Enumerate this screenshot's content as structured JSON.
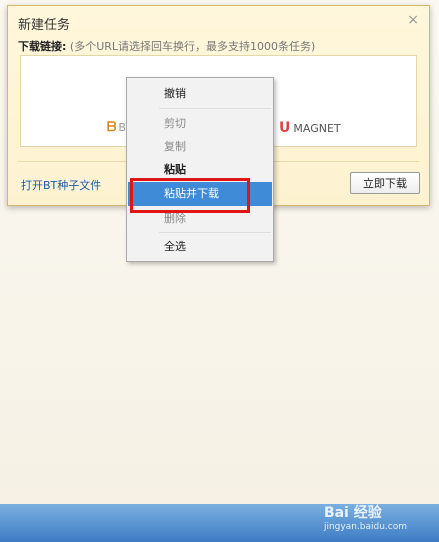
{
  "dialog": {
    "title": "新建任务",
    "close": "×",
    "download_label": "下载链接:",
    "hint": "(多个URL请选择回车换行，最多支持1000条任务)",
    "protocols": {
      "bt": "BT",
      "magnet": "MAGNET"
    },
    "open_bt": "打开BT种子文件",
    "download_now": "立即下载"
  },
  "context_menu": {
    "items": [
      {
        "label": "撤销",
        "state": "enabled"
      },
      {
        "label": "剪切",
        "state": "disabled"
      },
      {
        "label": "复制",
        "state": "disabled"
      },
      {
        "label": "粘贴",
        "state": "bold"
      },
      {
        "label": "粘贴并下载",
        "state": "highlighted"
      },
      {
        "label": "删除",
        "state": "disabled"
      },
      {
        "label": "全选",
        "state": "enabled"
      }
    ]
  },
  "watermark": {
    "brand": "Bai 经验",
    "sub": "jingyan.baidu.com"
  },
  "colors": {
    "highlight": "#3f8bd8",
    "annotation": "#e01515"
  }
}
